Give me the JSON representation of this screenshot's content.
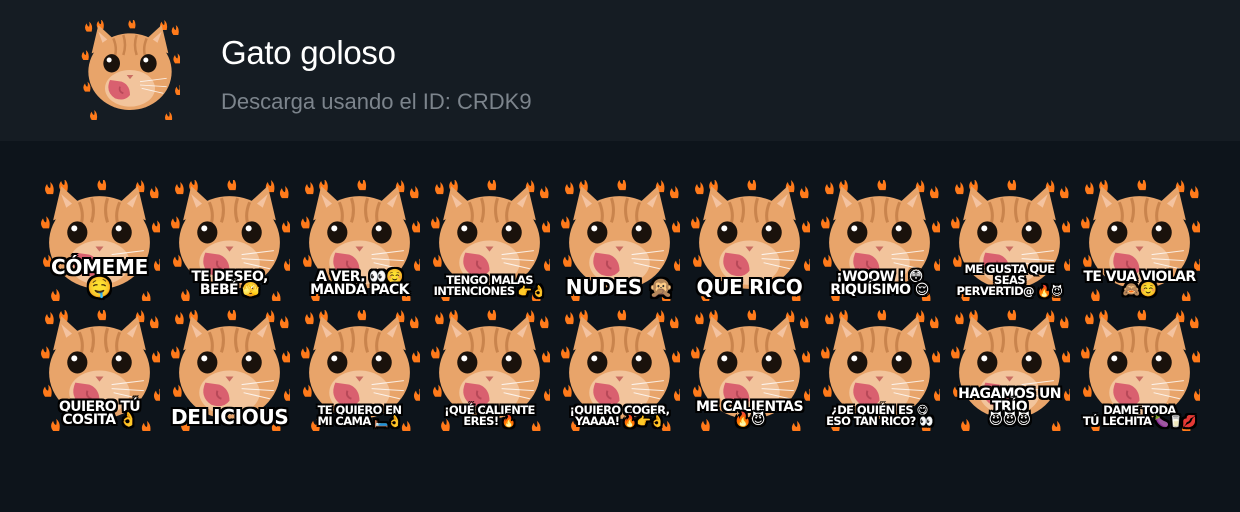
{
  "pack": {
    "title": "Gato goloso",
    "subtitle": "Descarga usando el ID: CRDK9"
  },
  "colors": {
    "background": "#0d141b",
    "header": "#151c23",
    "title": "#ffffff",
    "subtitle": "#7c848c",
    "cat_fur": "#e8a46a",
    "tongue": "#d9606f",
    "fire": "#ff7a1a"
  },
  "stickers": [
    {
      "caption": "CÓMEME 🤤",
      "size": "big"
    },
    {
      "caption": "TE DESEO, BEBÉ 🫣",
      "size": "normal"
    },
    {
      "caption": "A VER, 👀☺️\nMANDA PACK",
      "size": "normal"
    },
    {
      "caption": "TENGO MALAS\nINTENCIONES 👉👌",
      "size": "small"
    },
    {
      "caption": "NUDES 🙊",
      "size": "big"
    },
    {
      "caption": "QUE RICO",
      "size": "big"
    },
    {
      "caption": "¡WOOW ! 😳\nRIQUÍSIMO 😌",
      "size": "normal"
    },
    {
      "caption": "ME GUSTA QUE SEAS\nPERVERTID@ 🔥😈",
      "size": "small"
    },
    {
      "caption": "TE VUA VIOLAR 🙈☺️",
      "size": "normal"
    },
    {
      "caption": "QUIERO TÚ COSITA 👌",
      "size": "normal"
    },
    {
      "caption": "DELICIOUS",
      "size": "big"
    },
    {
      "caption": "TE QUIERO EN\nMI CAMA 🛏️👌",
      "size": "small"
    },
    {
      "caption": "¡QUÉ CALIENTE ERES! 🔥",
      "size": "small"
    },
    {
      "caption": "¡QUIERO COGER,\nYAAAA! 🔥👉👌",
      "size": "small"
    },
    {
      "caption": "ME CALIENTAS 🔥😈",
      "size": "normal"
    },
    {
      "caption": "¿DE QUIÉN ES 😋\nESO TAN RICO? 👀",
      "size": "small"
    },
    {
      "caption": "HAGAMOS UN TRÍO\n😈😈😈",
      "size": "normal"
    },
    {
      "caption": "DAME TODA\nTÚ LECHITA 🍆🥛💋",
      "size": "small"
    }
  ]
}
